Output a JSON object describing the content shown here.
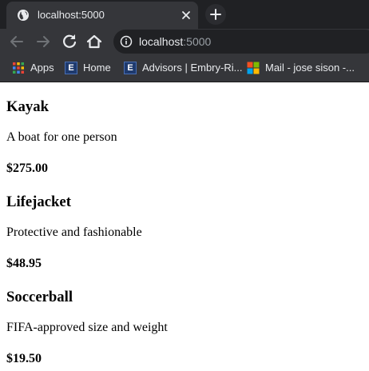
{
  "browser": {
    "tab": {
      "title": "localhost:5000"
    },
    "address": {
      "host": "localhost",
      "port": ":5000"
    },
    "bookmarks": [
      {
        "label": "Apps",
        "icon": "apps-grid-icon"
      },
      {
        "label": "Home",
        "icon": "e-badge-icon"
      },
      {
        "label": "Advisors | Embry-Ri...",
        "icon": "e-badge-icon"
      },
      {
        "label": "Mail - jose sison -...",
        "icon": "microsoft-logo-icon"
      }
    ]
  },
  "products": [
    {
      "name": "Kayak",
      "description": "A boat for one person",
      "price": "$275.00"
    },
    {
      "name": "Lifejacket",
      "description": "Protective and fashionable",
      "price": "$48.95"
    },
    {
      "name": "Soccerball",
      "description": "FIFA-approved size and weight",
      "price": "$19.50"
    }
  ]
}
